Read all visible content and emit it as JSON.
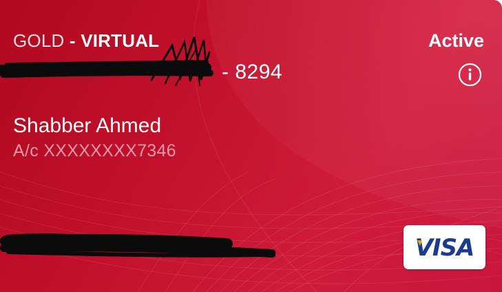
{
  "card": {
    "tier_label": "GOLD",
    "tier_separator": " - ",
    "tier_type": "VIRTUAL",
    "status": "Active",
    "number_suffix": "- 8294",
    "holder_name": "Shabber Ahmed",
    "account_label": "A/c XXXXXXXX7346",
    "network": "VISA"
  },
  "colors": {
    "card_background": "#c2102c",
    "network_text": "#1a3b8f",
    "account_text": "#e59aa8"
  },
  "icons": {
    "info": "info-circle-icon",
    "network_logo": "visa-logo-icon"
  }
}
